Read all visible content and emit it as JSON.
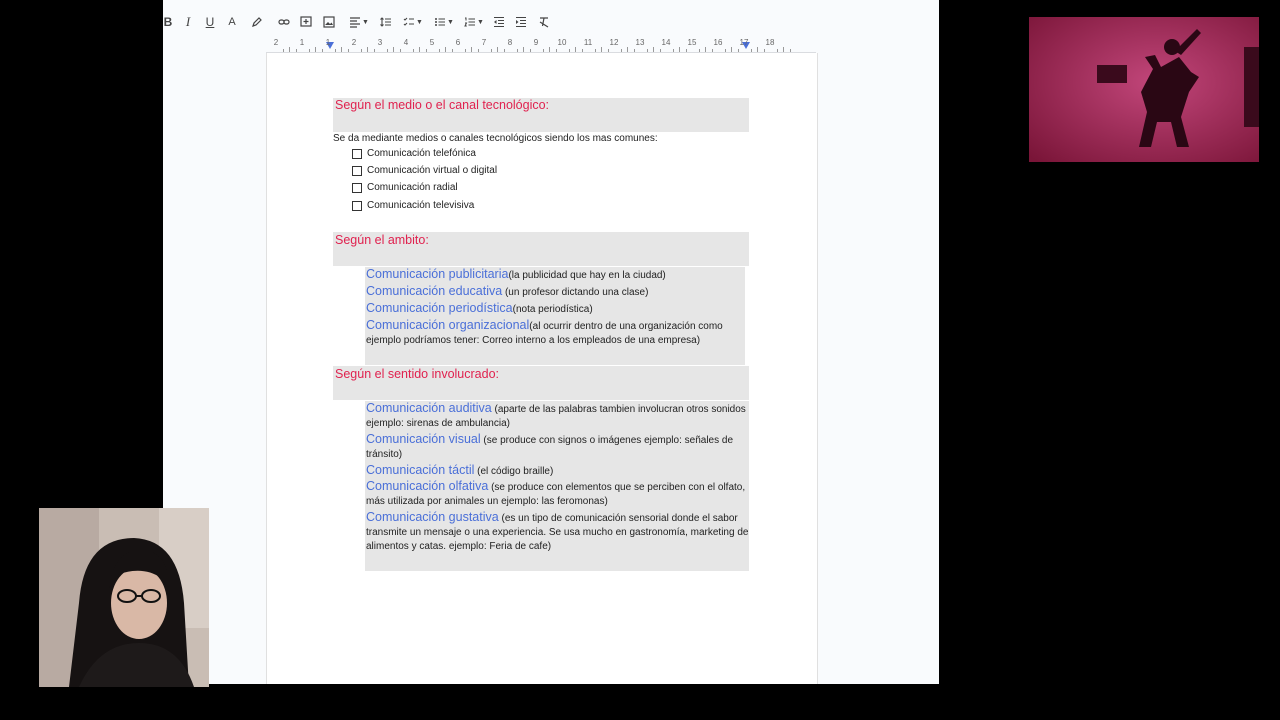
{
  "toolbar": {
    "bold": "B",
    "italic": "I",
    "underline": "U",
    "text_color": "A"
  },
  "ruler": {
    "labels": [
      "2",
      "1",
      "1",
      "2",
      "3",
      "4",
      "5",
      "6",
      "7",
      "8",
      "9",
      "10",
      "11",
      "12",
      "13",
      "14",
      "15",
      "16",
      "17",
      "18"
    ]
  },
  "doc": {
    "section1": {
      "heading": "Según el medio o el canal tecnológico:",
      "intro": "Se da mediante medios o canales tecnológicos siendo los mas comunes:",
      "items": [
        "Comunicación telefónica",
        "Comunicación virtual o digital",
        "Comunicación radial",
        "Comunicación televisiva"
      ]
    },
    "section2": {
      "heading": "Según el ambito:",
      "items": [
        {
          "title": "Comunicación publicitaria",
          "desc": "(la publicidad que hay en la ciudad)"
        },
        {
          "title": "Comunicación educativa",
          "desc": " (un profesor dictando una clase)"
        },
        {
          "title": "Comunicación periodística",
          "desc": "(nota periodística)"
        },
        {
          "title": "Comunicación organizacional",
          "desc": "(al ocurrir dentro de una organización como ejemplo podríamos tener:  Correo interno a los empleados de una empresa)"
        }
      ]
    },
    "section3": {
      "heading": "Según el sentido involucrado:",
      "items": [
        {
          "title": "Comunicación auditiva",
          "desc": " (aparte de las palabras tambien involucran otros sonidos ejemplo: sirenas de ambulancia)"
        },
        {
          "title": "Comunicación visual",
          "desc": " (se produce con signos o imágenes ejemplo: señales de tránsito)"
        },
        {
          "title": "Comunicación táctil",
          "desc": " (el código braille)"
        },
        {
          "title": "Comunicación olfativa",
          "desc": " (se produce con elementos que se perciben con el olfato, más utilizada por animales un ejemplo: las feromonas)"
        },
        {
          "title": "Comunicación gustativa",
          "desc": " (es un tipo de comunicación sensorial donde el sabor transmite un mensaje o una experiencia. Se usa mucho en gastronomía, marketing de alimentos y catas. ejemplo: Feria de cafe)"
        }
      ]
    }
  },
  "colors": {
    "heading": "#e0224f",
    "category": "#4a6fd8",
    "highlight": "#e6e6e6"
  }
}
